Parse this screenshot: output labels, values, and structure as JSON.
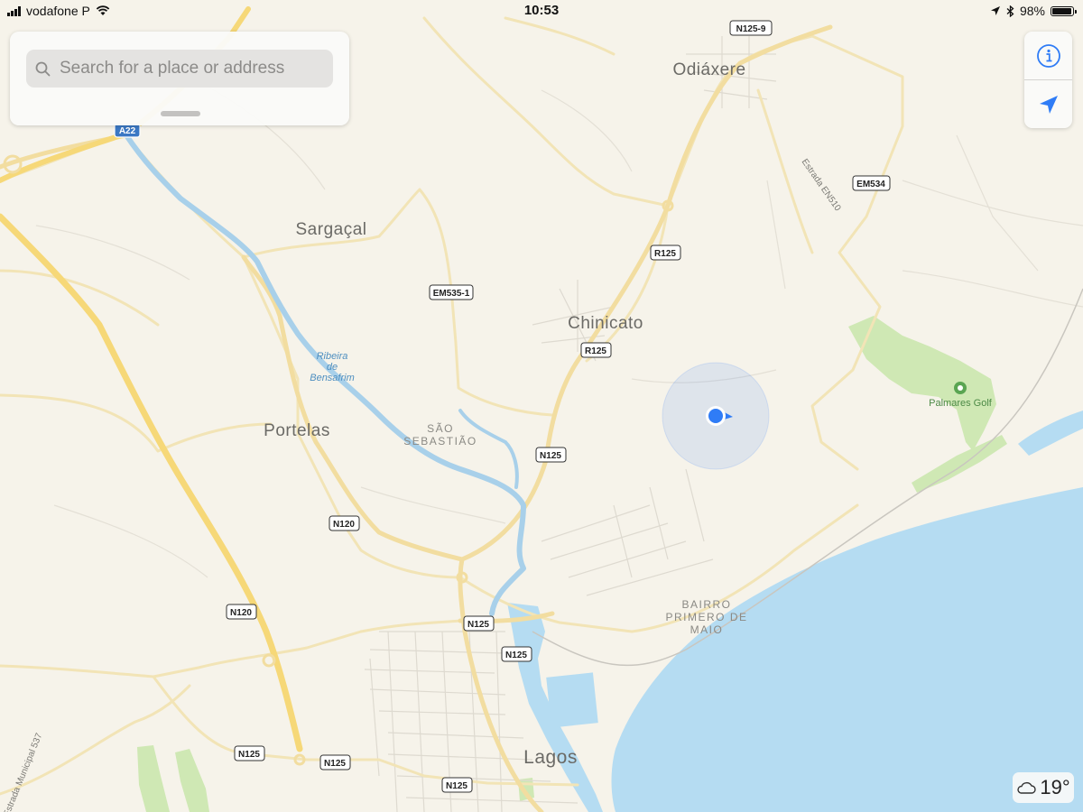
{
  "status_bar": {
    "carrier": "vodafone P",
    "time": "10:53",
    "battery_percent": "98%",
    "battery_level": 0.98,
    "icons": [
      "signal-icon",
      "wifi-icon",
      "location-arrow-icon",
      "bluetooth-icon",
      "battery-icon"
    ]
  },
  "search": {
    "placeholder": "Search for a place or address"
  },
  "map_controls": {
    "info_icon": "info-icon",
    "tracking_icon": "location-arrow-icon"
  },
  "weather": {
    "icon": "cloud-icon",
    "temperature": "19°"
  },
  "colors": {
    "land": "#f6f3ea",
    "water": "#b5dcf2",
    "river": "#a8d0ea",
    "major_road": "#f6d878",
    "minor_road": "#f2e4b6",
    "park": "#cfe8b4",
    "user_location": "#2f7cf6",
    "accent": "#2f7cf6"
  },
  "map": {
    "places": {
      "odiaxere": "Odiáxere",
      "sargacal": "Sargaçal",
      "chinicato": "Chinicato",
      "portelas": "Portelas",
      "lagos": "Lagos",
      "sao_sebastiao_1": "SÃO",
      "sao_sebastiao_2": "SEBASTIÃO",
      "bairro_1": "BAIRRO",
      "bairro_2": "PRIMERO DE",
      "bairro_3": "MAIO",
      "ribeira_1": "Ribeira",
      "ribeira_2": "de",
      "ribeira_3": "Bensafrim",
      "palmares_golf": "Palmares Golf",
      "estrada_en510": "Estrada EN510",
      "estrada_municipal": "Estrada Municipal 537"
    },
    "road_shields": {
      "a22": "A22",
      "n125_9": "N125-9",
      "em534": "EM534",
      "r125_a": "R125",
      "em535_1": "EM535-1",
      "r125_b": "R125",
      "n125_a": "N125",
      "n120_a": "N120",
      "n120_b": "N120",
      "n125_b": "N125",
      "n125_c": "N125",
      "n125_d": "N125",
      "n125_e": "N125",
      "n125_f": "N125"
    }
  }
}
